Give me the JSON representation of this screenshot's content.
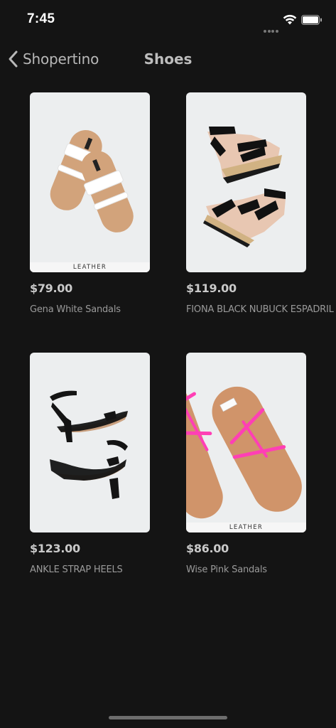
{
  "status_bar": {
    "time": "7:45"
  },
  "nav": {
    "back_label": "Shopertino",
    "title": "Shoes"
  },
  "products": [
    {
      "price": "$79.00",
      "name": "Gena White Sandals",
      "badge": "LEATHER"
    },
    {
      "price": "$119.00",
      "name": "FIONA BLACK NUBUCK ESPADRIL",
      "badge": ""
    },
    {
      "price": "$123.00",
      "name": "ANKLE STRAP HEELS",
      "badge": ""
    },
    {
      "price": "$86.00",
      "name": "Wise Pink Sandals",
      "badge": "LEATHER"
    }
  ],
  "colors": {
    "background": "#141414",
    "card_bg": "#eceeef",
    "price": "#c9c9c9",
    "name": "#9a9a9a",
    "pink": "#ff3fb5"
  }
}
